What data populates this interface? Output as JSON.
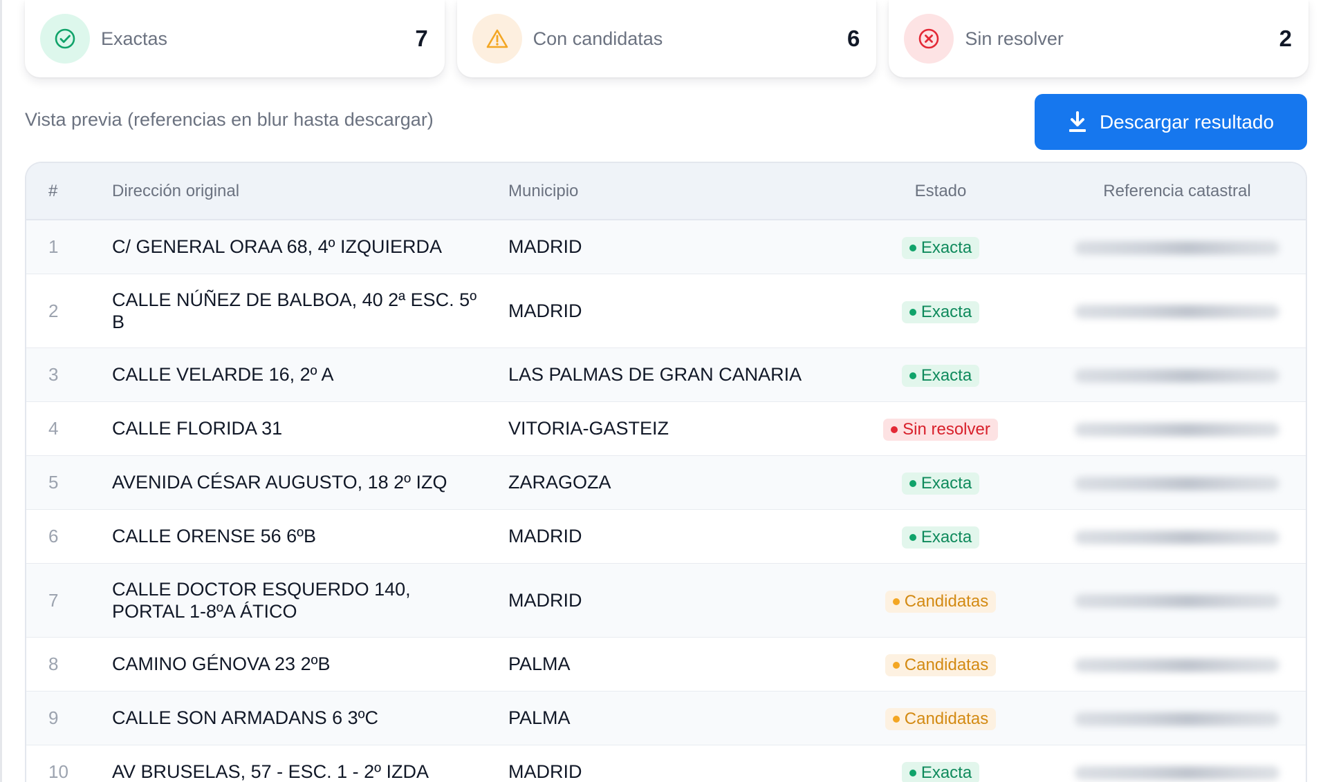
{
  "summary": [
    {
      "label": "Exactas",
      "count": "7",
      "icon": "check-circle-icon",
      "color": "#10a36a"
    },
    {
      "label": "Con candidatas",
      "count": "6",
      "icon": "warning-triangle-icon",
      "color": "#f3a623"
    },
    {
      "label": "Sin resolver",
      "count": "2",
      "icon": "x-circle-icon",
      "color": "#e32936"
    }
  ],
  "preview_text": "Vista previa (referencias en blur hasta descargar)",
  "download_button": {
    "label": "Descargar resultado",
    "icon": "download-icon"
  },
  "table": {
    "headers": {
      "num": "#",
      "address": "Dirección original",
      "municipality": "Municipio",
      "status": "Estado",
      "reference": "Referencia catastral"
    },
    "rows": [
      {
        "num": "1",
        "address": "C/ GENERAL ORAA 68, 4º IZQUIERDA",
        "municipality": "MADRID",
        "status": "Exacta",
        "status_type": "exacta"
      },
      {
        "num": "2",
        "address": "CALLE NÚÑEZ DE BALBOA, 40 2ª ESC. 5º B",
        "municipality": "MADRID",
        "status": "Exacta",
        "status_type": "exacta"
      },
      {
        "num": "3",
        "address": "CALLE VELARDE 16, 2º A",
        "municipality": "LAS PALMAS DE GRAN CANARIA",
        "status": "Exacta",
        "status_type": "exacta"
      },
      {
        "num": "4",
        "address": "CALLE FLORIDA 31",
        "municipality": "VITORIA-GASTEIZ",
        "status": "Sin resolver",
        "status_type": "sin"
      },
      {
        "num": "5",
        "address": "AVENIDA CÉSAR AUGUSTO, 18 2º IZQ",
        "municipality": "ZARAGOZA",
        "status": "Exacta",
        "status_type": "exacta"
      },
      {
        "num": "6",
        "address": "CALLE ORENSE 56 6ºB",
        "municipality": "MADRID",
        "status": "Exacta",
        "status_type": "exacta"
      },
      {
        "num": "7",
        "address": "CALLE DOCTOR ESQUERDO 140, PORTAL 1-8ºA ÁTICO",
        "municipality": "MADRID",
        "status": "Candidatas",
        "status_type": "cand"
      },
      {
        "num": "8",
        "address": "CAMINO GÉNOVA 23 2ºB",
        "municipality": "PALMA",
        "status": "Candidatas",
        "status_type": "cand"
      },
      {
        "num": "9",
        "address": "CALLE SON ARMADANS 6 3ºC",
        "municipality": "PALMA",
        "status": "Candidatas",
        "status_type": "cand"
      },
      {
        "num": "10",
        "address": "AV BRUSELAS, 57 - ESC. 1 - 2º IZDA",
        "municipality": "MADRID",
        "status": "Exacta",
        "status_type": "exacta"
      }
    ]
  },
  "colors": {
    "accent": "#1677ee",
    "exacta": "#10a36a",
    "candidatas": "#f3a623",
    "sin_resolver": "#e32936"
  }
}
